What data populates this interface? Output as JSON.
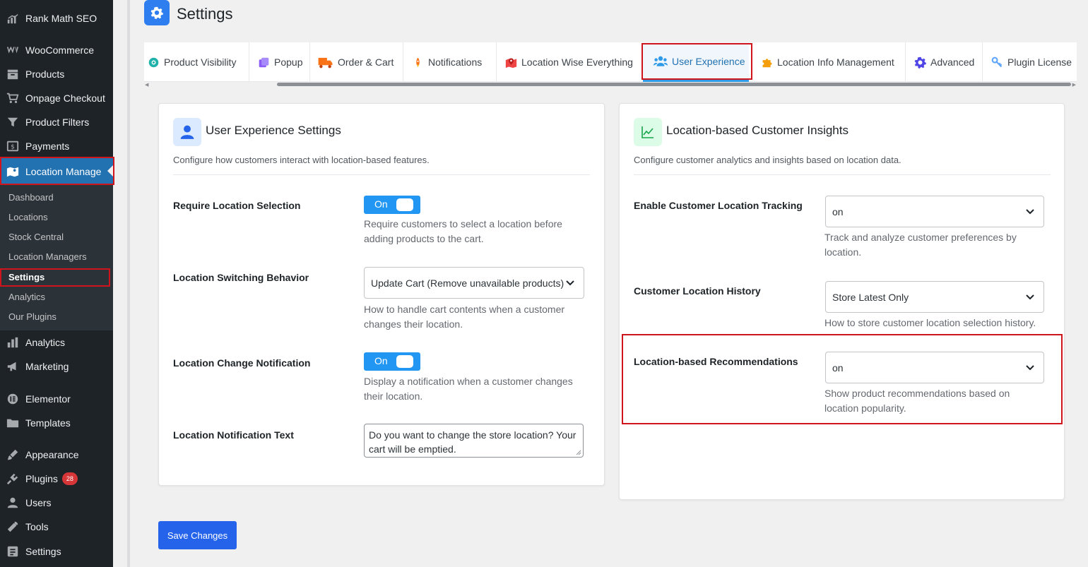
{
  "sidebar": {
    "items": [
      {
        "label": "Rank Math SEO",
        "icon": "rank-math-icon"
      },
      {
        "label": "WooCommerce",
        "icon": "woocommerce-icon"
      },
      {
        "label": "Products",
        "icon": "products-icon"
      },
      {
        "label": "Onpage Checkout",
        "icon": "cart-icon"
      },
      {
        "label": "Product Filters",
        "icon": "filter-icon"
      },
      {
        "label": "Payments",
        "icon": "payments-icon"
      },
      {
        "label": "Location Manage",
        "icon": "map-icon"
      },
      {
        "label": "Analytics",
        "icon": "analytics-icon"
      },
      {
        "label": "Marketing",
        "icon": "megaphone-icon"
      },
      {
        "label": "Elementor",
        "icon": "elementor-icon"
      },
      {
        "label": "Templates",
        "icon": "folder-icon"
      },
      {
        "label": "Appearance",
        "icon": "brush-icon"
      },
      {
        "label": "Plugins",
        "icon": "plugin-icon",
        "badge": "28"
      },
      {
        "label": "Users",
        "icon": "user-icon"
      },
      {
        "label": "Tools",
        "icon": "wrench-icon"
      },
      {
        "label": "Settings",
        "icon": "settings-icon"
      }
    ],
    "submenu": [
      "Dashboard",
      "Locations",
      "Stock Central",
      "Location Managers",
      "Settings",
      "Analytics",
      "Our Plugins"
    ],
    "active_submenu": "Settings"
  },
  "header": {
    "title": "Settings",
    "icon": "gear-icon"
  },
  "tabs": [
    {
      "label": "Product Visibility",
      "icon": "eye-icon",
      "color": "#20b2aa"
    },
    {
      "label": "Popup",
      "icon": "popup-icon",
      "color": "#8b5cf6"
    },
    {
      "label": "Order & Cart",
      "icon": "truck-icon",
      "color": "#f97316"
    },
    {
      "label": "Notifications",
      "icon": "rocket-icon",
      "color": "#f97316"
    },
    {
      "label": "Location Wise Everything",
      "icon": "map-marker-icon",
      "color": "#ef4444"
    },
    {
      "label": "User Experience",
      "icon": "users-icon",
      "color": "#2f9be8"
    },
    {
      "label": "Location Info Management",
      "icon": "puzzle-icon",
      "color": "#f59e0b"
    },
    {
      "label": "Advanced",
      "icon": "cog-icon",
      "color": "#4f46e5"
    },
    {
      "label": "Plugin License",
      "icon": "key-icon",
      "color": "#60a5fa"
    }
  ],
  "active_tab": "User Experience",
  "ux_card": {
    "title": "User Experience Settings",
    "description": "Configure how customers interact with location-based features.",
    "icon": "user-icon",
    "fields": {
      "require_location": {
        "label": "Require Location Selection",
        "toggle": "On",
        "help": [
          "Require customers to select a location before",
          "adding products to the cart."
        ]
      },
      "switching_behavior": {
        "label": "Location Switching Behavior",
        "value": "Update Cart (Remove unavailable products)",
        "help": [
          "How to handle cart contents when a customer",
          "changes their location."
        ]
      },
      "change_notification": {
        "label": "Location Change Notification",
        "toggle": "On",
        "help": [
          "Display a notification when a customer changes",
          "their location."
        ]
      },
      "notification_text": {
        "label": "Location Notification Text",
        "value_lines": [
          "Do you want to change the store location? Your",
          "cart will be emptied."
        ]
      }
    }
  },
  "insights_card": {
    "title": "Location-based Customer Insights",
    "description": "Configure customer analytics and insights based on location data.",
    "icon": "chart-line-icon",
    "fields": {
      "tracking": {
        "label": "Enable Customer Location Tracking",
        "value": "on",
        "help": [
          "Track and analyze customer preferences by",
          "location."
        ]
      },
      "history": {
        "label": "Customer Location History",
        "value": "Store Latest Only",
        "help": [
          "How to store customer location selection history."
        ]
      },
      "recommendations": {
        "label": "Location-based Recommendations",
        "value": "on",
        "help": [
          "Show product recommendations based on",
          "location popularity."
        ]
      }
    }
  },
  "save_label": "Save Changes",
  "colors": {
    "accent": "#2271b1",
    "toggle": "#2196f3",
    "save": "#2563eb",
    "highlight": "#d0141c"
  }
}
